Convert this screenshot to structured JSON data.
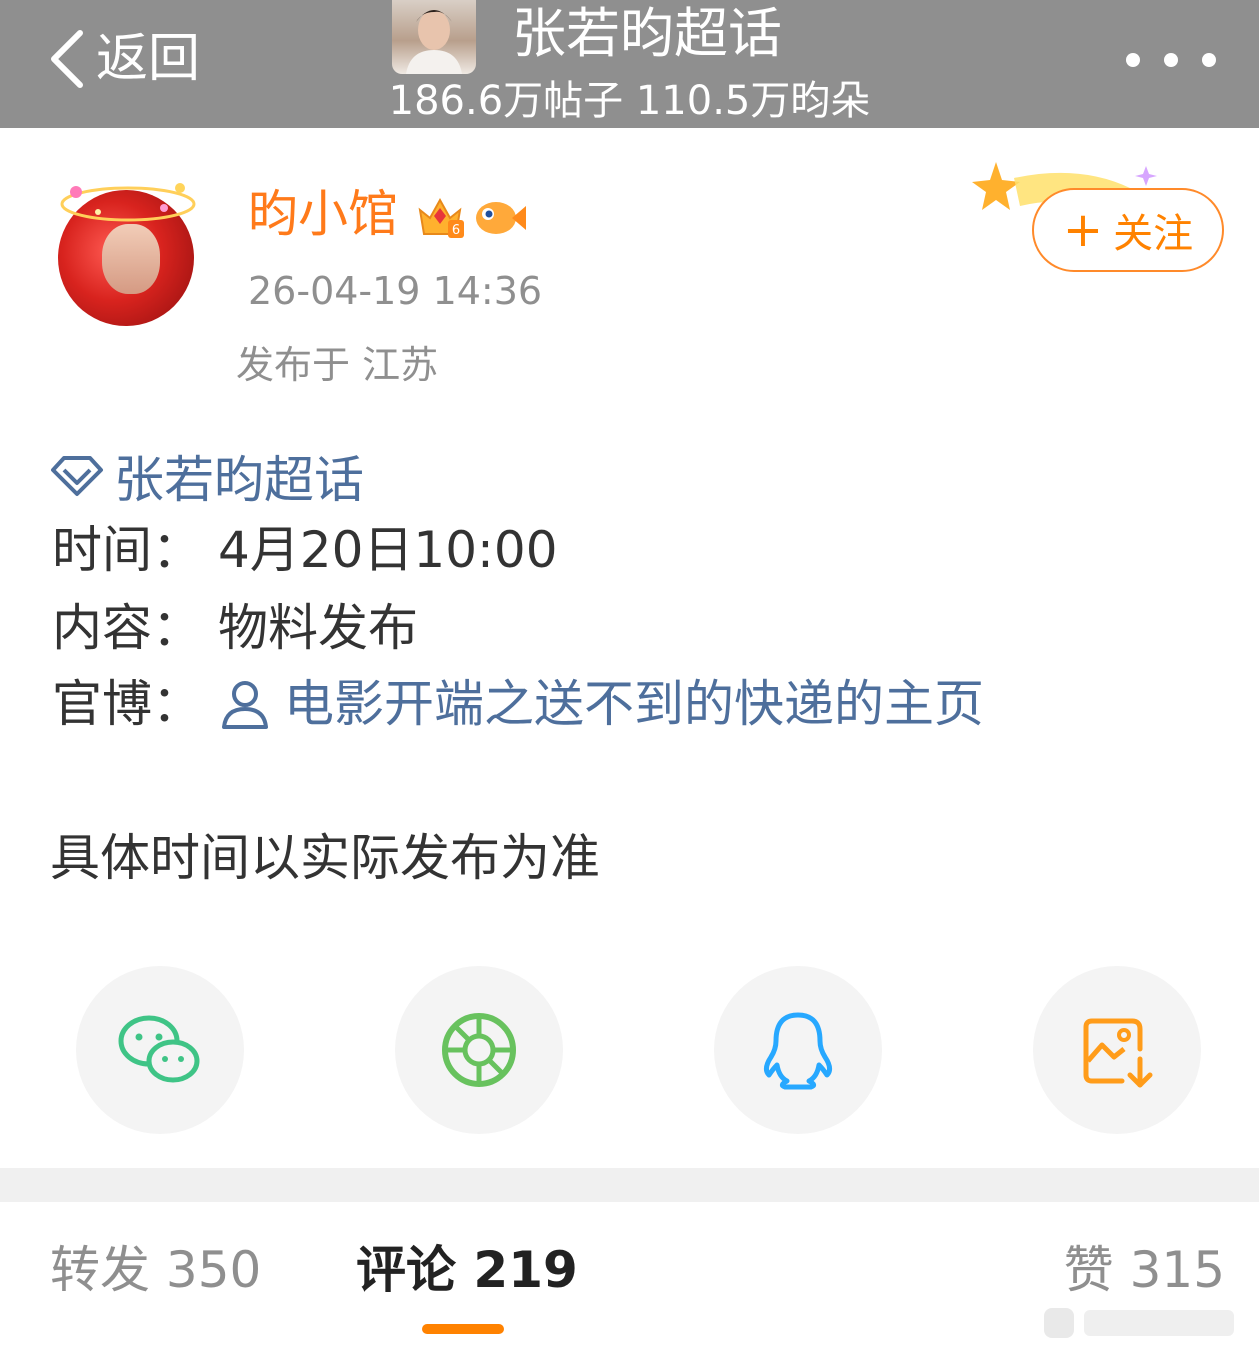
{
  "header": {
    "back_label": "返回",
    "topic_title": "张若昀超话",
    "topic_stats": "186.6万帖子 110.5万昀朵",
    "more_icon": "more-dots-icon"
  },
  "post": {
    "user_name": "昀小馆",
    "time": "26-04-19 14:36",
    "location": "发布于 江苏",
    "follow_label": "关注",
    "follow_plus": "+",
    "topic_tag": "张若昀超话",
    "rows": [
      {
        "key": "时间：",
        "value": "4月20日10:00"
      },
      {
        "key": "内容：",
        "value": "物料发布"
      },
      {
        "key": "官博：",
        "value": "电影开端之送不到的快递的主页"
      }
    ],
    "note": "具体时间以实际发布为准"
  },
  "share": {
    "items": [
      {
        "icon": "wechat-icon"
      },
      {
        "icon": "moments-icon"
      },
      {
        "icon": "qq-icon"
      },
      {
        "icon": "save-image-icon"
      }
    ]
  },
  "tabs": {
    "repost": "转发 350",
    "comment": "评论 219",
    "like": "赞 315"
  },
  "colors": {
    "accent": "#ff8200",
    "link": "#4e6f9c",
    "header_bg": "#8f8f8f"
  }
}
